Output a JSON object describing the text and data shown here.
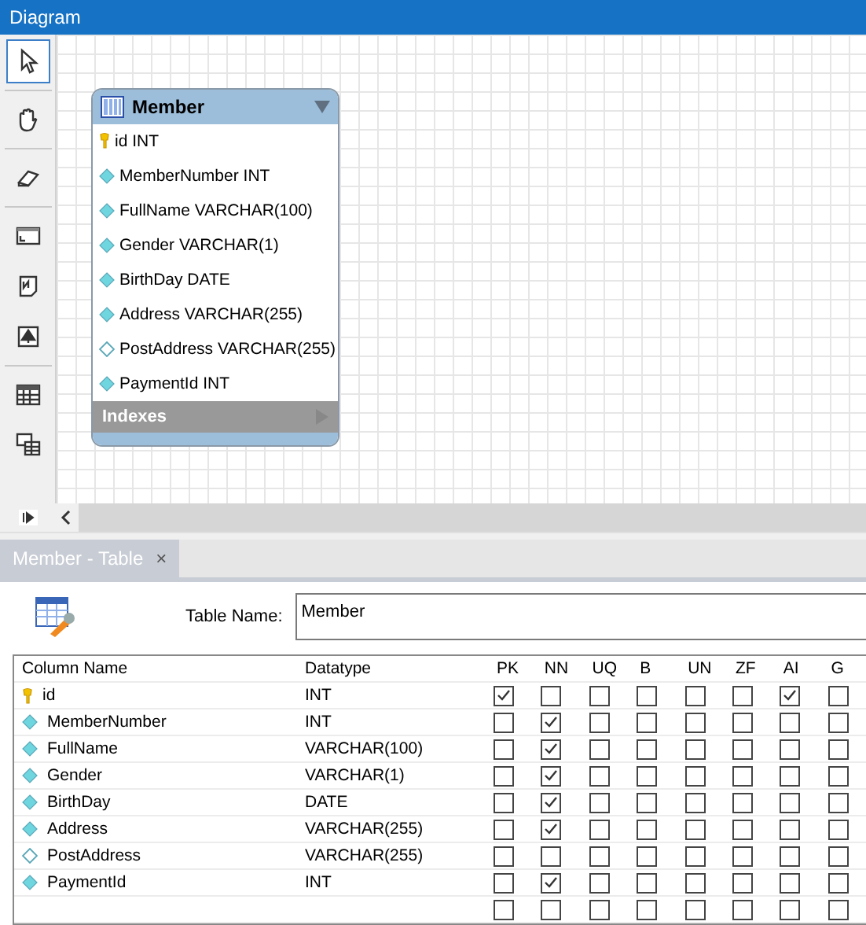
{
  "panel_title": "Diagram",
  "tools": [
    {
      "kind": "pointer",
      "selected": true
    },
    {
      "kind": "hand",
      "selected": false
    },
    {
      "kind": "eraser",
      "selected": false
    },
    {
      "kind": "layer",
      "selected": false
    },
    {
      "kind": "note",
      "selected": false
    },
    {
      "kind": "image",
      "selected": false
    },
    {
      "kind": "table",
      "selected": false
    },
    {
      "kind": "view",
      "selected": false
    }
  ],
  "entity": {
    "title": "Member",
    "columns": [
      {
        "text": "id INT",
        "kind": "key"
      },
      {
        "text": "MemberNumber INT",
        "kind": "required"
      },
      {
        "text": "FullName VARCHAR(100)",
        "kind": "required"
      },
      {
        "text": "Gender VARCHAR(1)",
        "kind": "required"
      },
      {
        "text": "BirthDay DATE",
        "kind": "required"
      },
      {
        "text": "Address VARCHAR(255)",
        "kind": "required"
      },
      {
        "text": "PostAddress VARCHAR(255)",
        "kind": "optional"
      },
      {
        "text": "PaymentId INT",
        "kind": "required"
      }
    ],
    "indexes_label": "Indexes"
  },
  "editor_tab": {
    "label": "Member - Table",
    "close": "×"
  },
  "table_name": {
    "label": "Table Name:",
    "value": "Member"
  },
  "grid": {
    "columns": [
      "Column Name",
      "Datatype",
      "PK",
      "NN",
      "UQ",
      "B",
      "UN",
      "ZF",
      "AI",
      "G"
    ],
    "rows": [
      {
        "name": "id",
        "datatype": "INT",
        "flags": [
          true,
          false,
          false,
          false,
          false,
          false,
          true,
          false
        ]
      },
      {
        "name": "MemberNumber",
        "datatype": "INT",
        "flags": [
          false,
          true,
          false,
          false,
          false,
          false,
          false,
          false
        ]
      },
      {
        "name": "FullName",
        "datatype": "VARCHAR(100)",
        "flags": [
          false,
          true,
          false,
          false,
          false,
          false,
          false,
          false
        ]
      },
      {
        "name": "Gender",
        "datatype": "VARCHAR(1)",
        "flags": [
          false,
          true,
          false,
          false,
          false,
          false,
          false,
          false
        ]
      },
      {
        "name": "BirthDay",
        "datatype": "DATE",
        "flags": [
          false,
          true,
          false,
          false,
          false,
          false,
          false,
          false
        ]
      },
      {
        "name": "Address",
        "datatype": "VARCHAR(255)",
        "flags": [
          false,
          true,
          false,
          false,
          false,
          false,
          false,
          false
        ]
      },
      {
        "name": "PostAddress",
        "datatype": "VARCHAR(255)",
        "flags": [
          false,
          false,
          false,
          false,
          false,
          false,
          false,
          false
        ]
      },
      {
        "name": "PaymentId",
        "datatype": "INT",
        "flags": [
          false,
          true,
          false,
          false,
          false,
          false,
          false,
          false
        ]
      },
      {
        "flags": [
          false,
          false,
          false,
          false,
          false,
          false,
          false,
          false
        ]
      }
    ]
  }
}
